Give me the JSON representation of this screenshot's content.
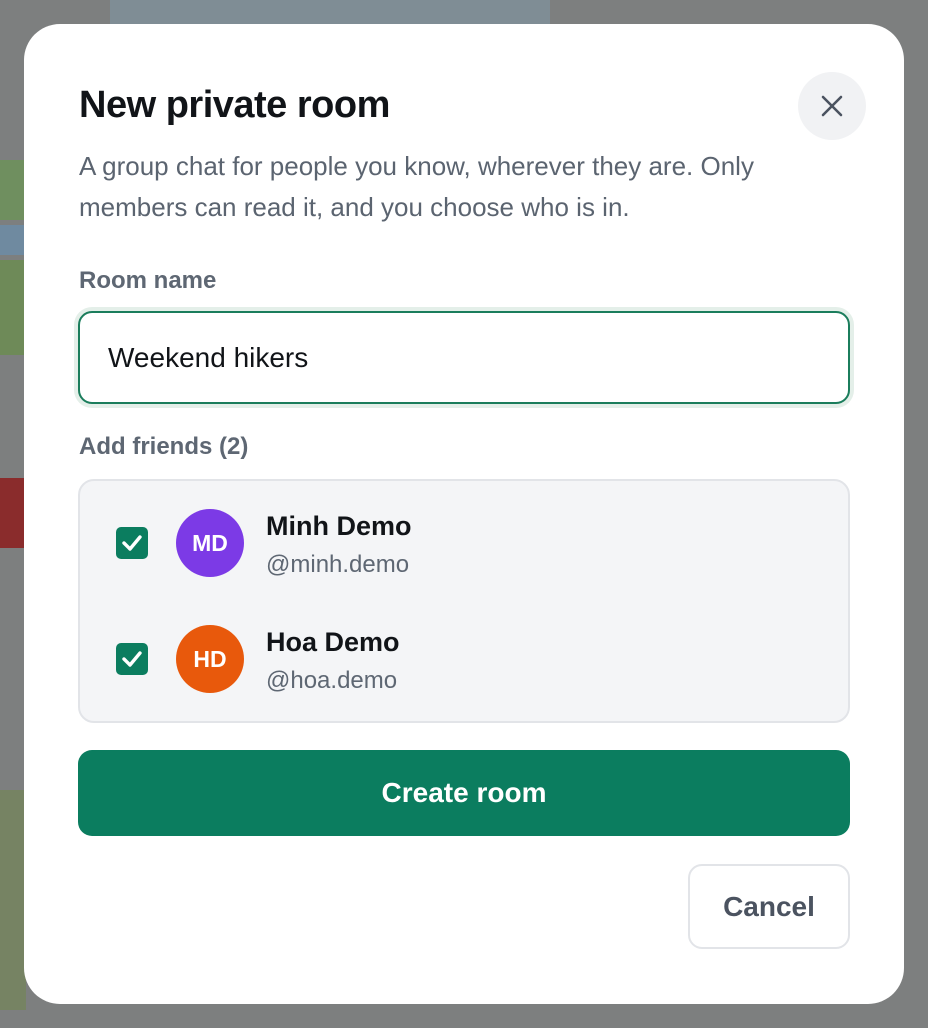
{
  "modal": {
    "title": "New private room",
    "description": "A group chat for people you know, wherever they are. Only members can read it, and you choose who is in.",
    "close_icon": "close-icon"
  },
  "room_name": {
    "label": "Room name",
    "value": "Weekend hikers"
  },
  "friends": {
    "label": "Add friends (2)",
    "items": [
      {
        "initials": "MD",
        "name": "Minh Demo",
        "handle": "@minh.demo",
        "checked": true,
        "avatar_color": "#7c3ae6"
      },
      {
        "initials": "HD",
        "name": "Hoa Demo",
        "handle": "@hoa.demo",
        "checked": true,
        "avatar_color": "#e8590c"
      }
    ]
  },
  "actions": {
    "create_label": "Create room",
    "cancel_label": "Cancel"
  },
  "colors": {
    "accent": "#0b7d5f",
    "overlay": "#7d7f7f"
  }
}
